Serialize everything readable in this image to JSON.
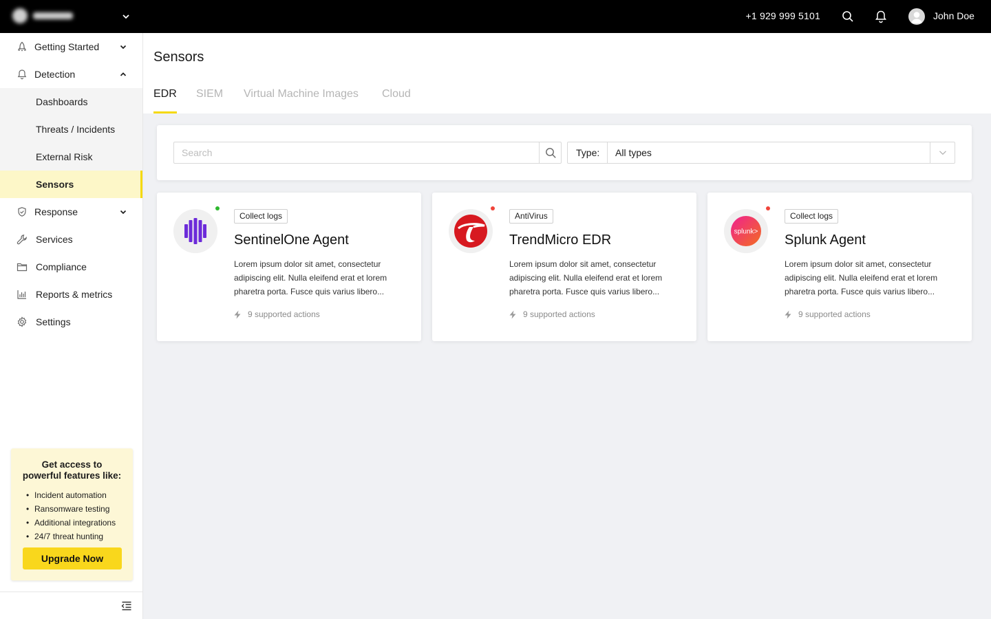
{
  "topbar": {
    "phone": "+1 929 999 5101",
    "username": "John Doe"
  },
  "sidebar": {
    "items": [
      {
        "label": "Getting Started",
        "icon": "rocket-icon",
        "expanded": false
      },
      {
        "label": "Detection",
        "icon": "bell-icon",
        "expanded": true,
        "children": [
          {
            "label": "Dashboards"
          },
          {
            "label": "Threats / Incidents"
          },
          {
            "label": "External Risk"
          },
          {
            "label": "Sensors",
            "active": true
          }
        ]
      },
      {
        "label": "Response",
        "icon": "shield-check-icon",
        "expanded": false
      },
      {
        "label": "Services",
        "icon": "wrench-icon"
      },
      {
        "label": "Compliance",
        "icon": "folder-icon"
      },
      {
        "label": "Reports & metrics",
        "icon": "bar-chart-icon"
      },
      {
        "label": "Settings",
        "icon": "gear-icon"
      }
    ],
    "promo": {
      "title_line1": "Get access to",
      "title_line2": "powerful features like:",
      "features": [
        "Incident automation",
        "Ransomware testing",
        "Additional integrations",
        "24/7 threat hunting"
      ],
      "button": "Upgrade Now"
    }
  },
  "page": {
    "title": "Sensors",
    "tabs": [
      "EDR",
      "SIEM",
      "Virtual Machine Images",
      "Cloud"
    ],
    "active_tab": "EDR"
  },
  "filters": {
    "search_placeholder": "Search",
    "type_label": "Type:",
    "type_value": "All types"
  },
  "cards": [
    {
      "tag": "Collect logs",
      "title": "SentinelOne Agent",
      "description": "Lorem ipsum dolor sit amet, consectetur adipiscing elit. Nulla eleifend erat et lorem pharetra porta. Fusce quis varius libero...",
      "actions": "9 supported actions",
      "status_color": "#2eb82e",
      "logo": "sentinelone-logo"
    },
    {
      "tag": "AntiVirus",
      "title": "TrendMicro EDR",
      "description": "Lorem ipsum dolor sit amet, consectetur adipiscing elit. Nulla eleifend erat et lorem pharetra porta. Fusce quis varius libero...",
      "actions": "9 supported actions",
      "status_color": "#f0443a",
      "logo": "trendmicro-logo"
    },
    {
      "tag": "Collect logs",
      "title": "Splunk Agent",
      "description": "Lorem ipsum dolor sit amet, consectetur adipiscing elit. Nulla eleifend erat et lorem pharetra porta. Fusce quis varius libero...",
      "actions": "9 supported actions",
      "status_color": "#f0443a",
      "logo": "splunk-logo",
      "logo_text": "splunk>"
    }
  ],
  "colors": {
    "accent": "#f5d90a",
    "topbar": "#000000",
    "background": "#f0f1f4"
  }
}
